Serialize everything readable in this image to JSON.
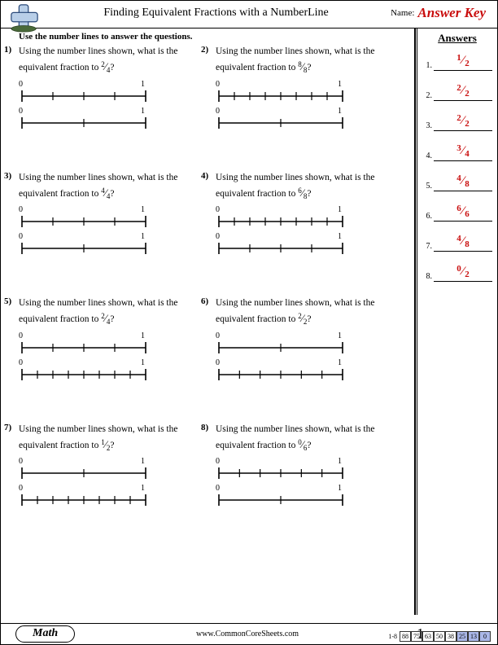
{
  "header": {
    "title": "Finding Equivalent Fractions with a NumberLine",
    "name_label": "Name:",
    "answer_key": "Answer Key"
  },
  "instructions": "Use the number lines to answer the questions.",
  "answers_header": "Answers",
  "problems": [
    {
      "num": "1)",
      "text1": "Using the number lines shown, what is the equivalent fraction to ",
      "frac_n": "2",
      "frac_d": "4",
      "text2": "?",
      "nl": [
        4,
        2
      ]
    },
    {
      "num": "2)",
      "text1": "Using the number lines shown, what is the equivalent fraction to ",
      "frac_n": "8",
      "frac_d": "8",
      "text2": "?",
      "nl": [
        8,
        2
      ]
    },
    {
      "num": "3)",
      "text1": "Using the number lines shown, what is the equivalent fraction to ",
      "frac_n": "4",
      "frac_d": "4",
      "text2": "?",
      "nl": [
        4,
        2
      ]
    },
    {
      "num": "4)",
      "text1": "Using the number lines shown, what is the equivalent fraction to ",
      "frac_n": "6",
      "frac_d": "8",
      "text2": "?",
      "nl": [
        8,
        4
      ]
    },
    {
      "num": "5)",
      "text1": "Using the number lines shown, what is the equivalent fraction to ",
      "frac_n": "2",
      "frac_d": "4",
      "text2": "?",
      "nl": [
        4,
        8
      ]
    },
    {
      "num": "6)",
      "text1": "Using the number lines shown, what is the equivalent fraction to ",
      "frac_n": "2",
      "frac_d": "2",
      "text2": "?",
      "nl": [
        2,
        6
      ]
    },
    {
      "num": "7)",
      "text1": "Using the number lines shown, what is the equivalent fraction to ",
      "frac_n": "1",
      "frac_d": "2",
      "text2": "?",
      "nl": [
        2,
        8
      ]
    },
    {
      "num": "8)",
      "text1": "Using the number lines shown, what is the equivalent fraction to ",
      "frac_n": "0",
      "frac_d": "6",
      "text2": "?",
      "nl": [
        6,
        2
      ]
    }
  ],
  "answers": [
    {
      "num": "1.",
      "n": "1",
      "d": "2"
    },
    {
      "num": "2.",
      "n": "2",
      "d": "2"
    },
    {
      "num": "3.",
      "n": "2",
      "d": "2"
    },
    {
      "num": "4.",
      "n": "3",
      "d": "4"
    },
    {
      "num": "5.",
      "n": "4",
      "d": "8"
    },
    {
      "num": "6.",
      "n": "6",
      "d": "6"
    },
    {
      "num": "7.",
      "n": "4",
      "d": "8"
    },
    {
      "num": "8.",
      "n": "0",
      "d": "2"
    }
  ],
  "footer": {
    "subject": "Math",
    "site": "www.CommonCoreSheets.com",
    "page": "1",
    "score_range": "1-8",
    "scores": [
      "88",
      "75",
      "63",
      "50",
      "38",
      "25",
      "13",
      "0"
    ]
  },
  "nl_labels": {
    "start": "0",
    "end": "1"
  }
}
